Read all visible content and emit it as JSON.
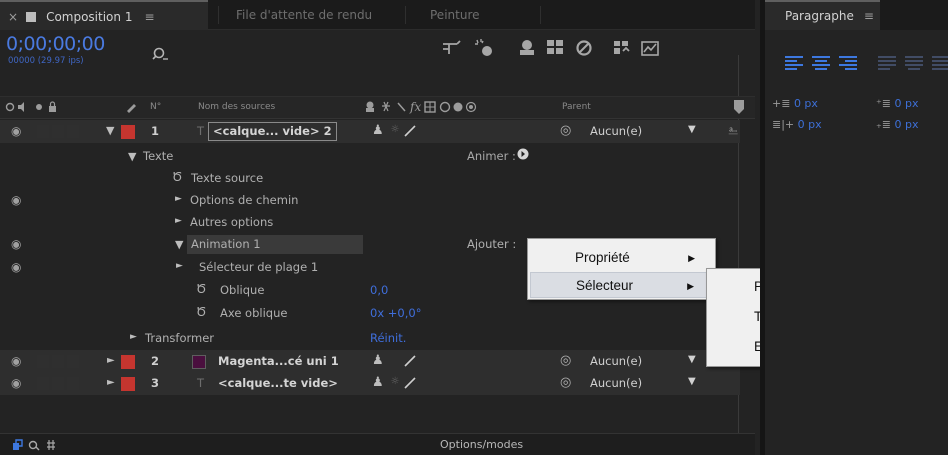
{
  "tabs": {
    "comp_close": "×",
    "composition": "Composition 1",
    "menu_glyph": "≡",
    "render_queue": "File d'attente de rendu",
    "paint": "Peinture"
  },
  "timecode": "0;00;00;00",
  "frame_info": "00000 (29.97 ips)",
  "search_icon": "search-icon",
  "columns": {
    "num": "N°",
    "source_name": "Nom des sources",
    "parent": "Parent"
  },
  "layers": [
    {
      "num": "1",
      "name": "<calque... vide> 2",
      "parent": "Aucun(e)",
      "color": "#c5352f"
    },
    {
      "num": "2",
      "name": "Magenta...cé uni 1",
      "parent": "Aucun(e)",
      "color": "#c5352f"
    },
    {
      "num": "3",
      "name": "<calque...te vide>",
      "parent": "Aucun(e)",
      "color": "#c5352f"
    }
  ],
  "tree": {
    "texte": "Texte",
    "animer": "Animer :",
    "texte_source": "Texte source",
    "options_chemin": "Options de chemin",
    "autres_options": "Autres options",
    "animation": "Animation 1",
    "ajouter": "Ajouter :",
    "selecteur_plage": "Sélecteur de plage 1",
    "oblique": "Oblique",
    "oblique_value": "0,0",
    "axe_oblique": "Axe oblique",
    "axe_oblique_value": "0x +0,0°",
    "transformer": "Transformer",
    "reinit": "Réinit."
  },
  "footer": {
    "options_modes": "Options/modes"
  },
  "context_menu": {
    "items": [
      "Propriété",
      "Sélecteur"
    ],
    "selected": "Sélecteur"
  },
  "submenu": {
    "items": [
      "Plage",
      "Tremblement",
      "Expression"
    ]
  },
  "paragraph": {
    "title": "Paragraphe",
    "menu_glyph": "≡",
    "indent_left": "0 px",
    "space_before": "0 px",
    "indent_first": "0 px",
    "space_after": "0 px"
  },
  "colors": {
    "accent_blue": "#3f6edb",
    "label_red": "#c5352f",
    "magenta_swatch": "#4a0f3e",
    "menu_bg": "#f0f0f0"
  }
}
